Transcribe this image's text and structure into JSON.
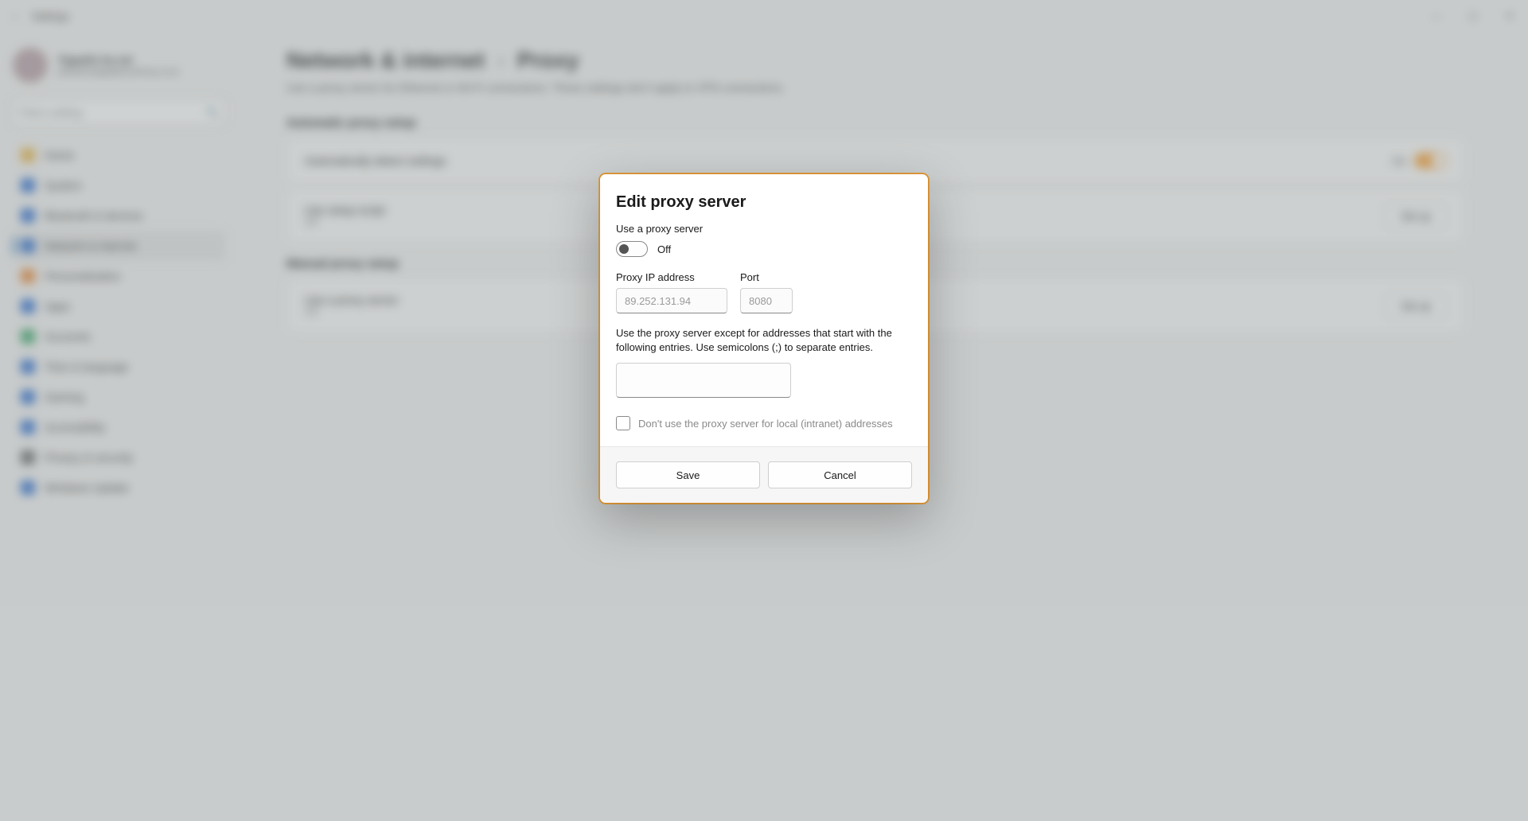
{
  "window": {
    "title": "Settings",
    "back_icon": "←",
    "min_icon": "—",
    "max_icon": "▢",
    "close_icon": "✕"
  },
  "profile": {
    "name": "Yigaalis ka zai",
    "email": "yihankuniga@anuehraa.com"
  },
  "search": {
    "placeholder": "Find a setting"
  },
  "sidebar": {
    "items": [
      {
        "label": "Home",
        "color": "#e8b54a"
      },
      {
        "label": "System",
        "color": "#2f6fd0"
      },
      {
        "label": "Bluetooth & devices",
        "color": "#2f6fd0"
      },
      {
        "label": "Network & internet",
        "color": "#2f6fd0"
      },
      {
        "label": "Personalization",
        "color": "#e8893a"
      },
      {
        "label": "Apps",
        "color": "#2f6fd0"
      },
      {
        "label": "Accounts",
        "color": "#3aa66a"
      },
      {
        "label": "Time & language",
        "color": "#2f6fd0"
      },
      {
        "label": "Gaming",
        "color": "#2f6fd0"
      },
      {
        "label": "Accessibility",
        "color": "#2f6fd0"
      },
      {
        "label": "Privacy & security",
        "color": "#6a6a6a"
      },
      {
        "label": "Windows Update",
        "color": "#2f6fd0"
      }
    ],
    "selected_index": 3
  },
  "page": {
    "crumb_parent": "Network & internet",
    "crumb_sep": "›",
    "crumb_current": "Proxy",
    "description": "Use a proxy server for Ethernet or Wi-Fi connections. These settings don't apply to VPN connections.",
    "section_auto": "Automatic proxy setup",
    "auto_row_title": "Automatically detect settings",
    "auto_on_label": "On",
    "script_row_title": "Use setup script",
    "script_row_sub": "Off",
    "section_manual": "Manual proxy setup",
    "manual_row_title": "Use a proxy server",
    "manual_row_sub": "Off",
    "setup_btn": "Set up"
  },
  "dialog": {
    "title": "Edit proxy server",
    "use_label": "Use a proxy server",
    "toggle_state": "Off",
    "ip_label": "Proxy IP address",
    "ip_value": "89.252.131.94",
    "port_label": "Port",
    "port_value": "8080",
    "exceptions_label": "Use the proxy server except for addresses that start with the following entries. Use semicolons (;) to separate entries.",
    "exceptions_value": "",
    "local_checkbox_label": "Don't use the proxy server for local (intranet) addresses",
    "save": "Save",
    "cancel": "Cancel"
  }
}
